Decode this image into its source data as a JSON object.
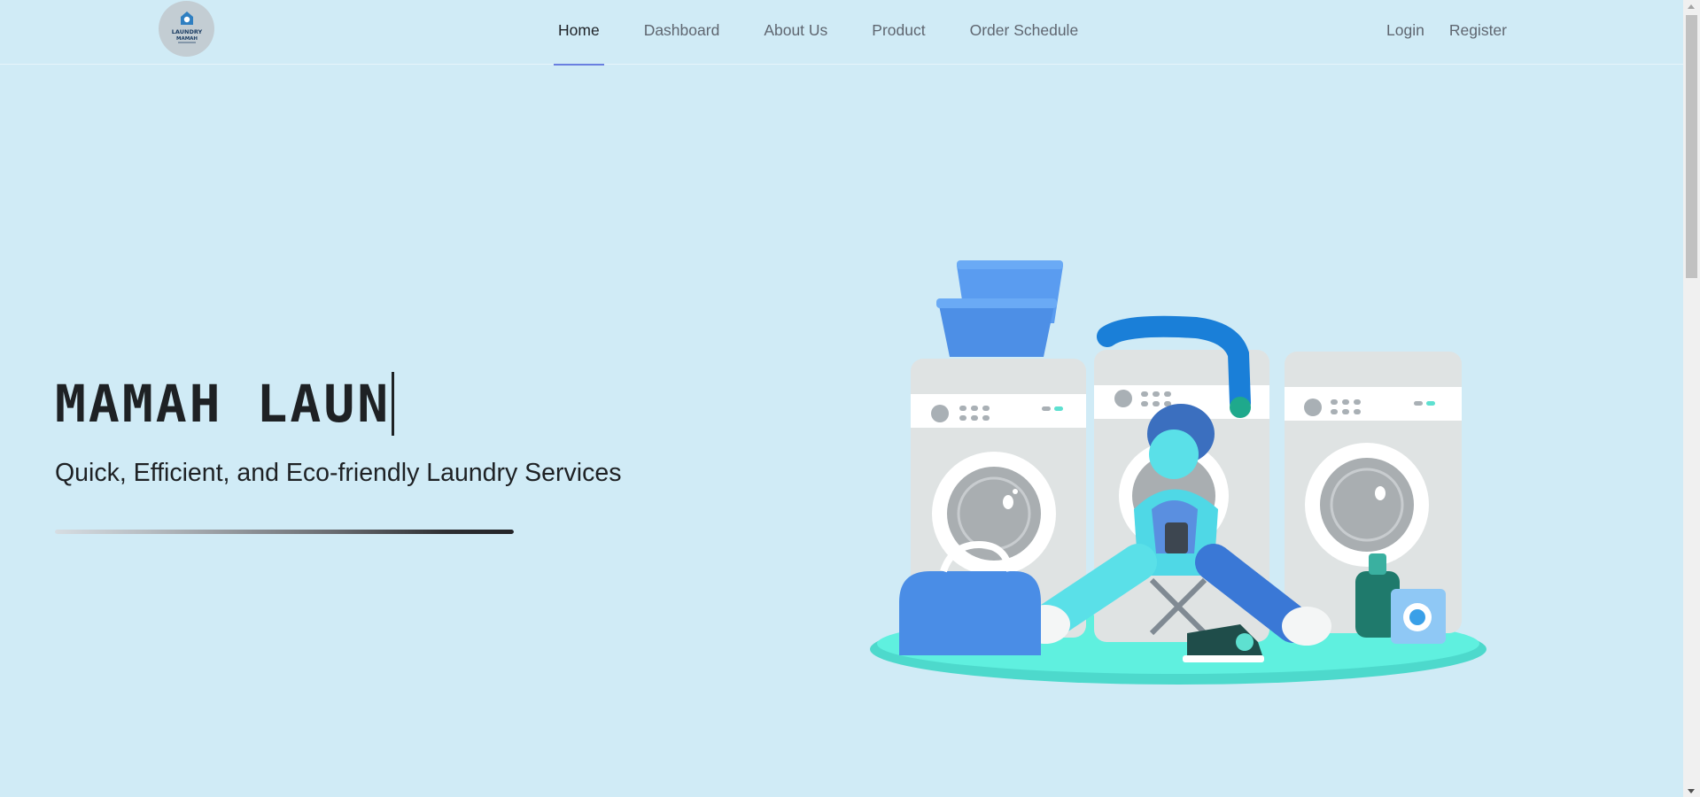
{
  "brand": {
    "logo_alt": "Laundry Mamah logo",
    "logo_text_line1": "LAUNDRY",
    "logo_text_line2": "MAMAH"
  },
  "nav": {
    "items": [
      {
        "label": "Home",
        "active": true
      },
      {
        "label": "Dashboard",
        "active": false
      },
      {
        "label": "About Us",
        "active": false
      },
      {
        "label": "Product",
        "active": false
      },
      {
        "label": "Order Schedule",
        "active": false
      }
    ],
    "auth": {
      "login_label": "Login",
      "register_label": "Register"
    }
  },
  "hero": {
    "title": "MAMAH LAUN",
    "subtitle": "Quick, Efficient, and Eco-friendly Laundry Services",
    "illustration": "laundromat-illustration"
  },
  "colors": {
    "background": "#d0ebf6",
    "active_underline": "#6a7fe0",
    "text_primary": "#1e2124",
    "nav_text": "#5f6670"
  }
}
